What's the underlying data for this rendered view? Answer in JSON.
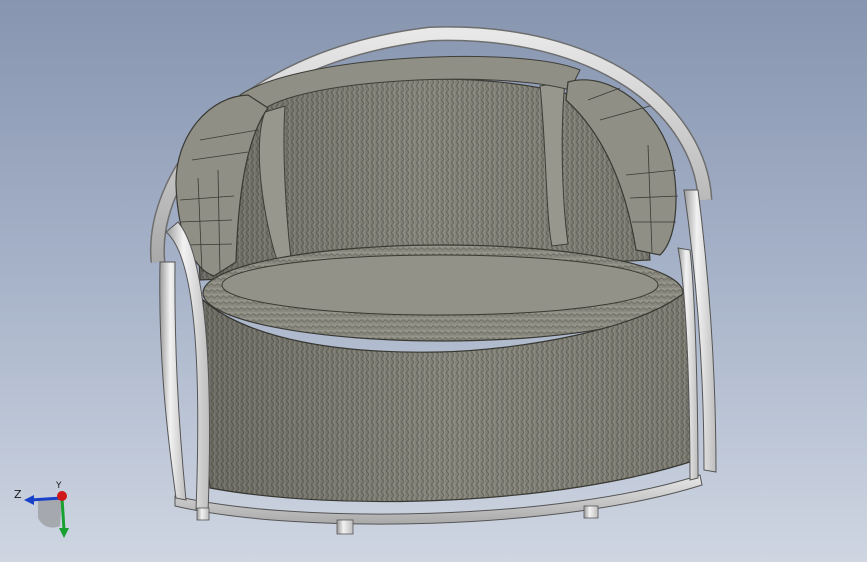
{
  "viewport": {
    "background_top": "#8795b0",
    "background_bottom": "#cfd6e2",
    "model": "chair-model"
  },
  "triad": {
    "labels": {
      "z": "Z",
      "y": "Y"
    },
    "colors": {
      "x": "#d01818",
      "y": "#18a030",
      "z": "#1840c8"
    }
  }
}
